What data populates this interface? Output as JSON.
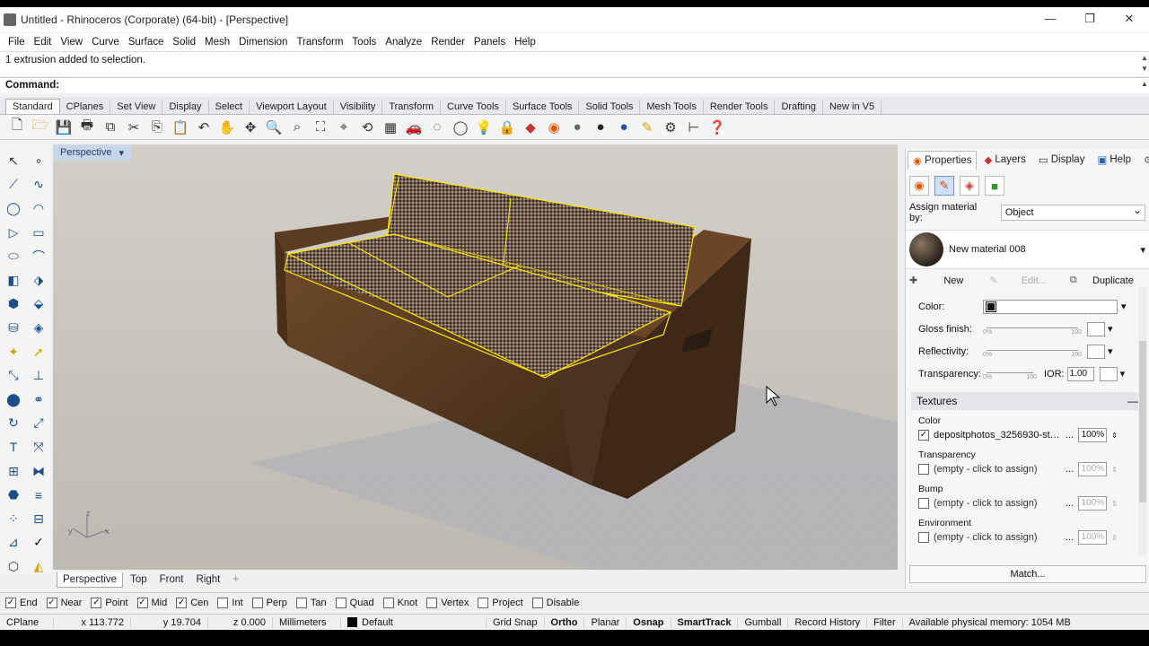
{
  "window": {
    "title": "Untitled - Rhinoceros (Corporate) (64-bit) - [Perspective]",
    "minimize": "—",
    "restore": "❐",
    "close": "✕"
  },
  "menu": [
    "File",
    "Edit",
    "View",
    "Curve",
    "Surface",
    "Solid",
    "Mesh",
    "Dimension",
    "Transform",
    "Tools",
    "Analyze",
    "Render",
    "Panels",
    "Help"
  ],
  "command": {
    "history": "1 extrusion added to selection.",
    "prompt": "Command:"
  },
  "toolbar_tabs": [
    "Standard",
    "CPlanes",
    "Set View",
    "Display",
    "Select",
    "Viewport Layout",
    "Visibility",
    "Transform",
    "Curve Tools",
    "Surface Tools",
    "Solid Tools",
    "Mesh Tools",
    "Render Tools",
    "Drafting",
    "New in V5"
  ],
  "toolbar_icons": [
    "new-file",
    "open",
    "save",
    "print",
    "import",
    "cut",
    "copy",
    "paste",
    "undo",
    "pan",
    "rotate-view",
    "zoom",
    "zoom-window",
    "zoom-extents",
    "zoom-selected",
    "rotate",
    "grid",
    "car",
    "render-preview",
    "lights",
    "bulb",
    "lock",
    "material",
    "color-wheel",
    "sphere-gray",
    "sphere-dark",
    "sphere-blue",
    "pen",
    "gear",
    "dimension",
    "help"
  ],
  "viewport": {
    "title": "Perspective",
    "axis_x": "x",
    "axis_y": "y",
    "axis_z": "z"
  },
  "viewport_tabs": [
    "Perspective",
    "Top",
    "Front",
    "Right",
    "+"
  ],
  "osnaps": [
    {
      "label": "End",
      "checked": true
    },
    {
      "label": "Near",
      "checked": true
    },
    {
      "label": "Point",
      "checked": true
    },
    {
      "label": "Mid",
      "checked": true
    },
    {
      "label": "Cen",
      "checked": true
    },
    {
      "label": "Int",
      "checked": false
    },
    {
      "label": "Perp",
      "checked": false
    },
    {
      "label": "Tan",
      "checked": false
    },
    {
      "label": "Quad",
      "checked": false
    },
    {
      "label": "Knot",
      "checked": false
    },
    {
      "label": "Vertex",
      "checked": false
    },
    {
      "label": "Project",
      "checked": false
    },
    {
      "label": "Disable",
      "checked": false
    }
  ],
  "status": {
    "cplane": "CPlane",
    "x": "x 113.772",
    "y": "y 19.704",
    "z": "z 0.000",
    "units": "Millimeters",
    "layer": "Default",
    "grid_snap": "Grid Snap",
    "ortho": "Ortho",
    "planar": "Planar",
    "osnap": "Osnap",
    "smarttrack": "SmartTrack",
    "gumball": "Gumball",
    "record_history": "Record History",
    "filter": "Filter",
    "memory": "Available physical memory: 1054 MB"
  },
  "panel": {
    "tabs": [
      "Properties",
      "Layers",
      "Display",
      "Help"
    ],
    "assign_label": "Assign material by:",
    "assign_value": "Object",
    "material_name": "New material 008",
    "new_label": "New",
    "edit_label": "Edit...",
    "duplicate_label": "Duplicate",
    "color_label": "Color:",
    "gloss_label": "Gloss finish:",
    "reflectivity_label": "Reflectivity:",
    "transparency_label": "Transparency:",
    "slider_min": "0%",
    "slider_max": "100",
    "ior_label": "IOR:",
    "ior_value": "1.00",
    "textures_header": "Textures",
    "textures_collapse": "—",
    "textures": [
      {
        "label": "Color",
        "name": "depositphotos_3256930-stock...",
        "checked": true,
        "pct": "100%"
      },
      {
        "label": "Transparency",
        "name": "(empty - click to assign)",
        "checked": false,
        "pct": "100%"
      },
      {
        "label": "Bump",
        "name": "(empty - click to assign)",
        "checked": false,
        "pct": "100%"
      },
      {
        "label": "Environment",
        "name": "(empty - click to assign)",
        "checked": false,
        "pct": "100%"
      }
    ],
    "more": "...",
    "match_label": "Match..."
  },
  "colors": {
    "viewport_bg": "#c8c4bd",
    "wood": "#5a3c22",
    "selection": "#ffe800",
    "panel_accent": "#1c5fb0"
  }
}
